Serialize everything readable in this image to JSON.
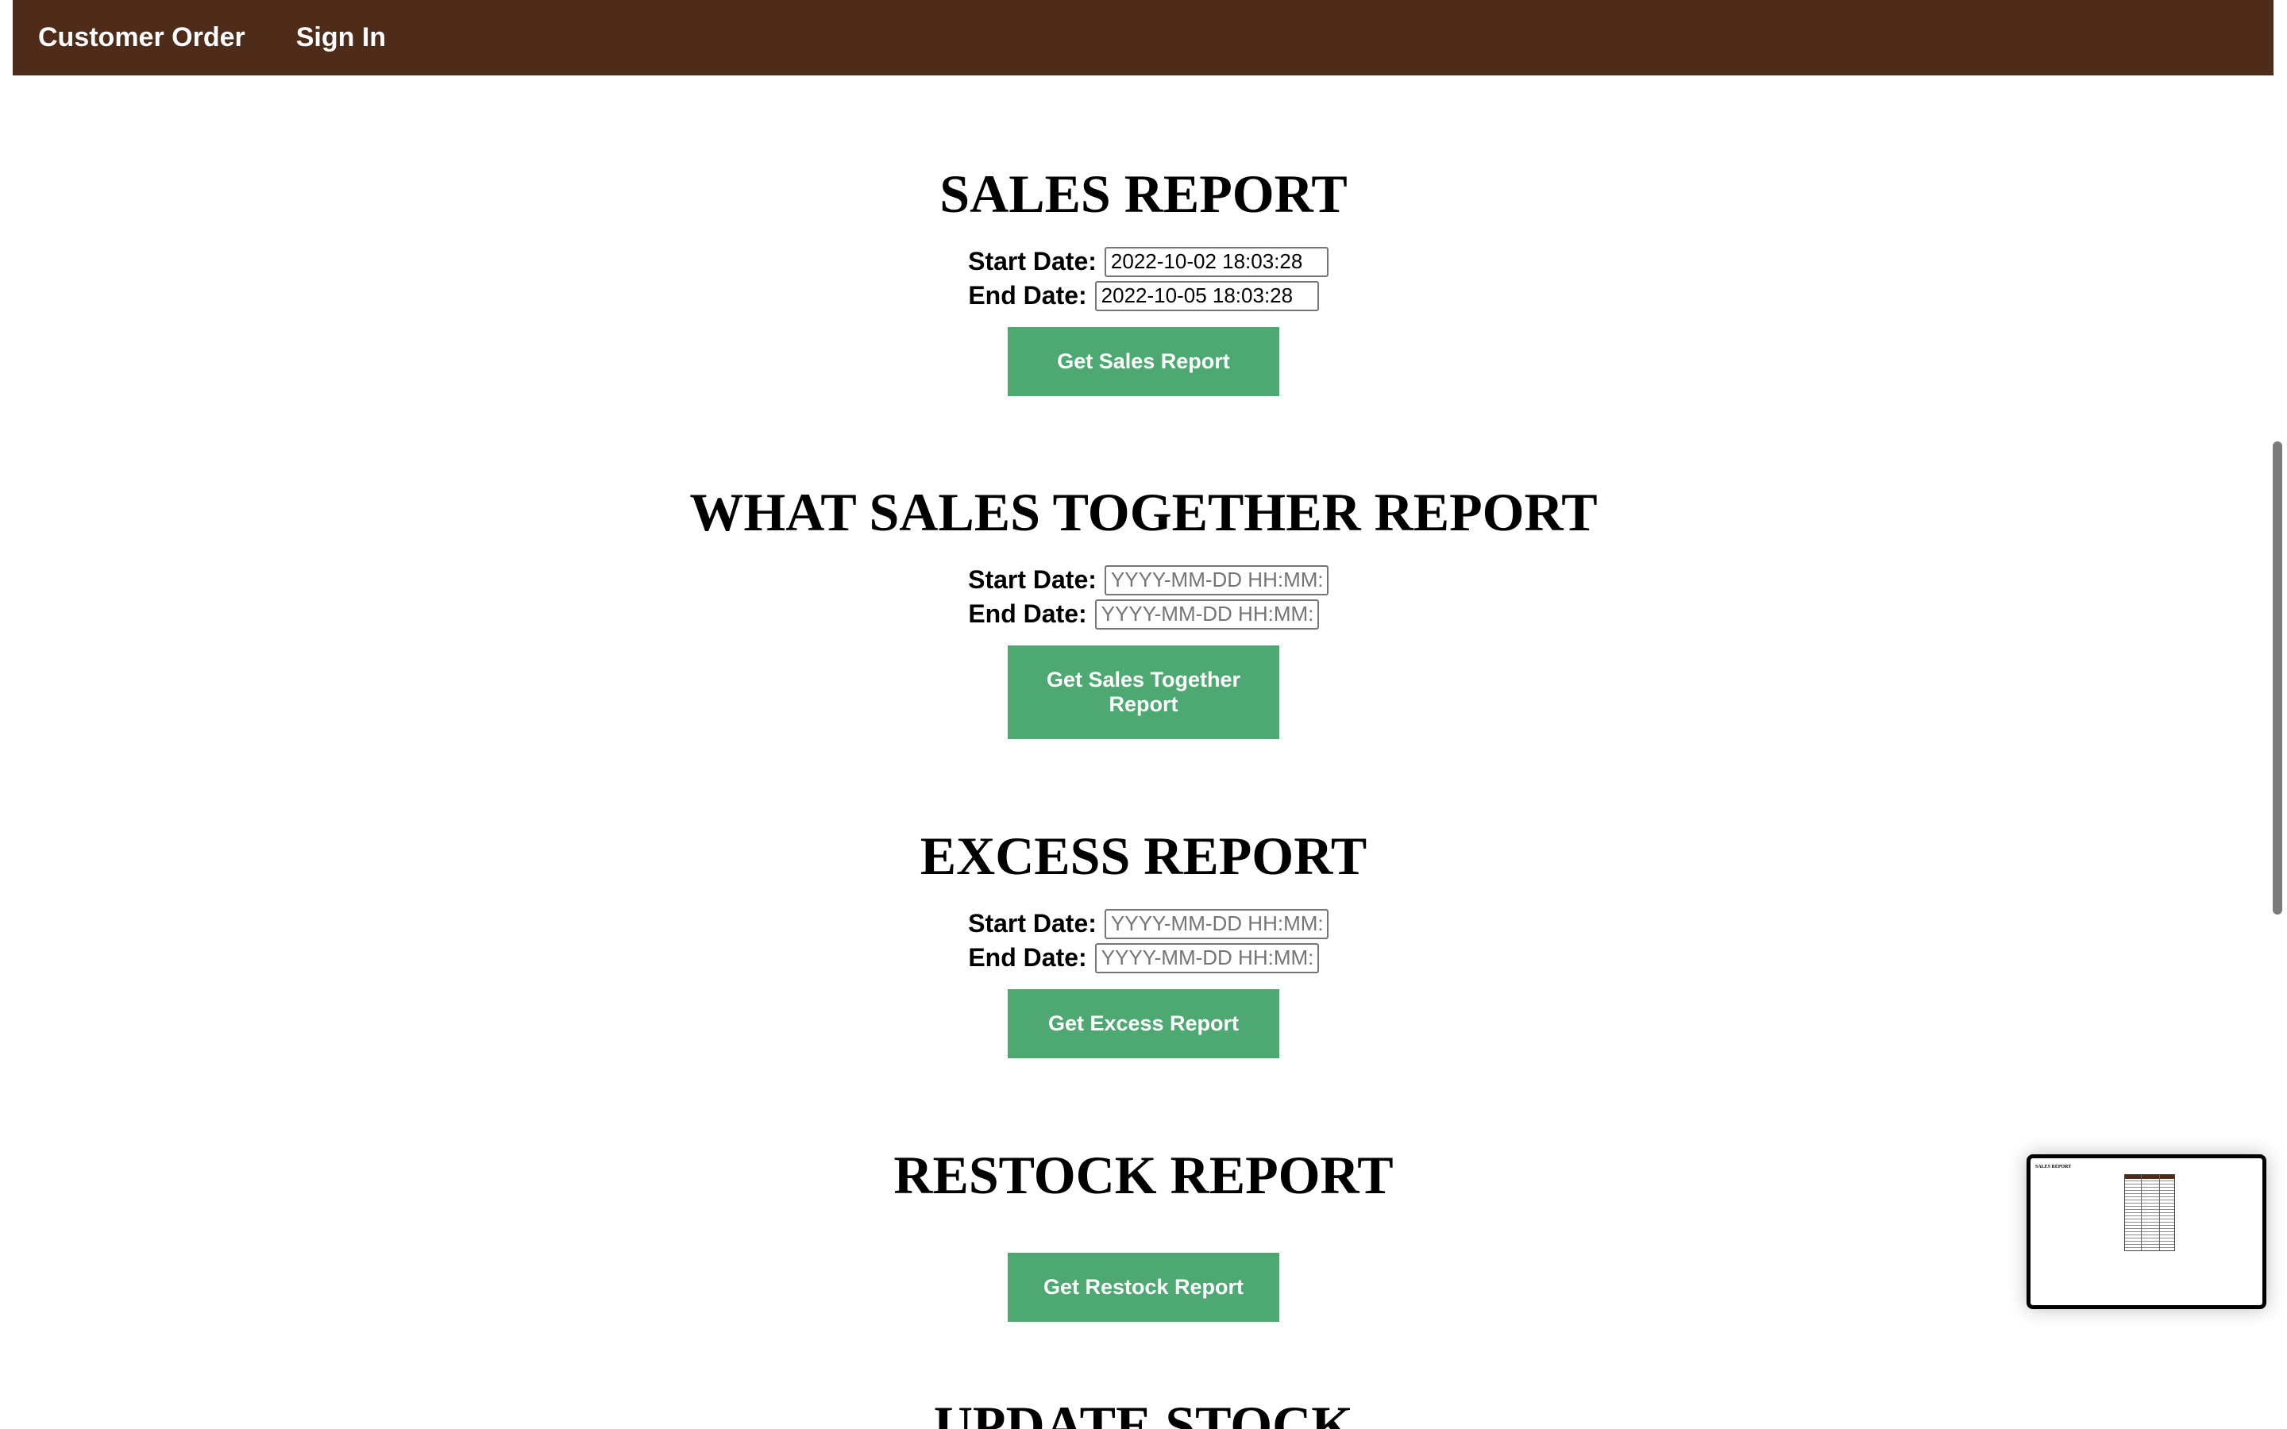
{
  "nav": {
    "items": [
      {
        "label": "Customer Order"
      },
      {
        "label": "Sign In"
      }
    ],
    "background": "#4f2b1a"
  },
  "sales_report": {
    "title": "SALES REPORT",
    "start_label": "Start Date:",
    "start_value": "2022-10-02 18:03:28",
    "end_label": "End Date:",
    "end_value": "2022-10-05 18:03:28",
    "button_label": "Get Sales Report"
  },
  "sales_together_report": {
    "title": "WHAT SALES TOGETHER REPORT",
    "start_label": "Start Date:",
    "start_placeholder": "YYYY-MM-DD HH:MM:SS",
    "end_label": "End Date:",
    "end_placeholder": "YYYY-MM-DD HH:MM:SS",
    "button_label": "Get Sales Together Report"
  },
  "excess_report": {
    "title": "EXCESS REPORT",
    "start_label": "Start Date:",
    "start_placeholder": "YYYY-MM-DD HH:MM:SS",
    "end_label": "End Date:",
    "end_placeholder": "YYYY-MM-DD HH:MM:SS",
    "button_label": "Get Excess Report"
  },
  "restock_report": {
    "title": "RESTOCK REPORT",
    "button_label": "Get Restock Report"
  },
  "update_stock": {
    "title": "UPDATE STOCK"
  },
  "thumbnail": {
    "title": "SALES REPORT"
  },
  "colors": {
    "button": "#4ea872",
    "nav": "#4f2b1a",
    "text": "#000000"
  }
}
